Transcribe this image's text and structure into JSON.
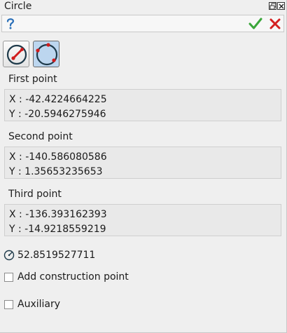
{
  "window": {
    "title": "Circle",
    "buttons": [
      "restore-icon",
      "close-icon"
    ]
  },
  "toolbar": {
    "help_icon": "question-mark-icon",
    "ok_icon": "checkmark-icon",
    "cancel_icon": "x-icon",
    "colors": {
      "ok": "#3aa63a",
      "cancel": "#d42020",
      "help": "#2a6fb8"
    }
  },
  "modes": [
    {
      "name": "center-and-radius",
      "icon": "circle-center-radius-icon",
      "active": false
    },
    {
      "name": "three-points",
      "icon": "circle-three-points-icon",
      "active": true
    }
  ],
  "points": [
    {
      "label": "First point",
      "x_prefix": "X : ",
      "x": "-42.4224664225",
      "y_prefix": "Y : ",
      "y": "-20.5946275946"
    },
    {
      "label": "Second point",
      "x_prefix": "X : ",
      "x": "-140.586080586",
      "y_prefix": "Y : ",
      "y": "1.35653235653"
    },
    {
      "label": "Third point",
      "x_prefix": "X : ",
      "x": "-136.393162393",
      "y_prefix": "Y : ",
      "y": "-14.9218559219"
    }
  ],
  "radius": {
    "icon": "radius-icon",
    "value": "52.8519527711"
  },
  "options": {
    "construction_point": {
      "label": "Add construction point",
      "checked": false
    },
    "auxiliary": {
      "label": "Auxiliary",
      "checked": false
    }
  }
}
